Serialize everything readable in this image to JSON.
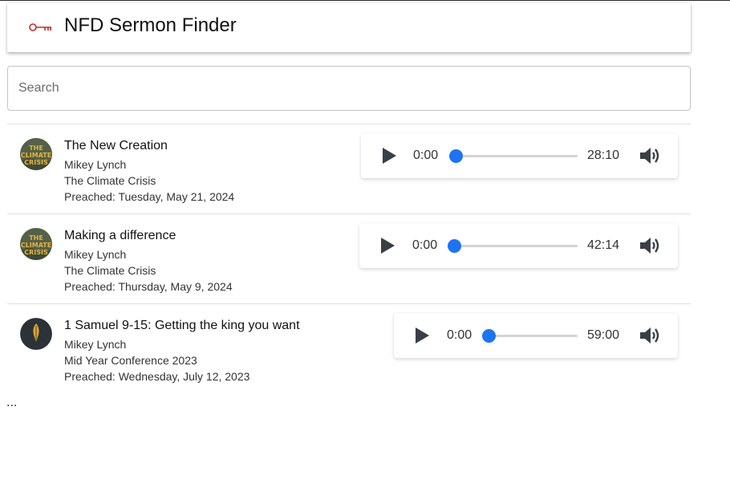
{
  "app": {
    "title": "NFD Sermon Finder",
    "logo_icon": "key-icon",
    "accent_color": "#c62828"
  },
  "search": {
    "placeholder": "Search",
    "value": ""
  },
  "sermons": [
    {
      "title": "The New Creation",
      "speaker": "Mikey Lynch",
      "series": "The Climate Crisis",
      "preached": "Preached: Tuesday, May 21, 2024",
      "artwork": "the-climate-crisis-artwork",
      "artwork_text": "THE CLIMATE CRISIS",
      "current_time": "0:00",
      "duration": "28:10",
      "progress": 0
    },
    {
      "title": "Making a difference",
      "speaker": "Mikey Lynch",
      "series": "The Climate Crisis",
      "preached": "Preached: Thursday, May 9, 2024",
      "artwork": "the-climate-crisis-artwork",
      "artwork_text": "THE CLIMATE CRISIS",
      "current_time": "0:00",
      "duration": "42:14",
      "progress": 0
    },
    {
      "title": "1 Samuel 9-15: Getting the king you want",
      "speaker": "Mikey Lynch",
      "series": "Mid Year Conference 2023",
      "preached": "Preached: Wednesday, July 12, 2023",
      "artwork": "feather-artwork",
      "artwork_text": "",
      "current_time": "0:00",
      "duration": "59:00",
      "progress": 0
    }
  ],
  "player_icons": {
    "play": "play-icon",
    "volume": "volume-icon"
  },
  "player_accent": "#1e73f0",
  "more_indicator": "..."
}
